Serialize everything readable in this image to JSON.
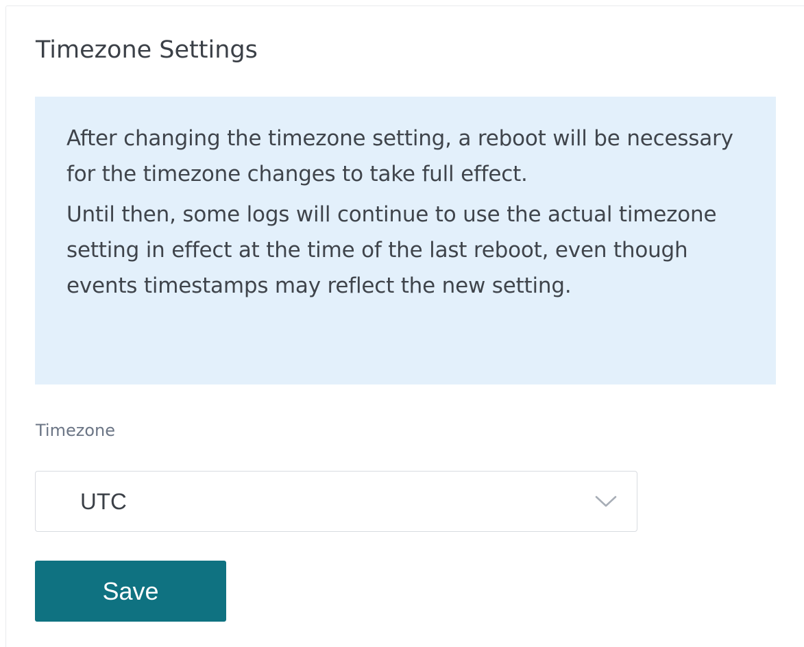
{
  "page": {
    "title": "Timezone Settings"
  },
  "notice": {
    "paragraphs": [
      "After changing the timezone setting, a reboot will be necessary for the timezone changes to take full effect.",
      "Until then, some logs will continue to use the actual timezone setting in effect at the time of the last reboot, even though events timestamps may reflect the new setting."
    ],
    "background_color": "#e3f0fb"
  },
  "timezone_field": {
    "label": "Timezone",
    "selected_value": "UTC",
    "icon": "chevron-down-icon"
  },
  "actions": {
    "save_label": "Save",
    "save_color": "#0f7281"
  }
}
